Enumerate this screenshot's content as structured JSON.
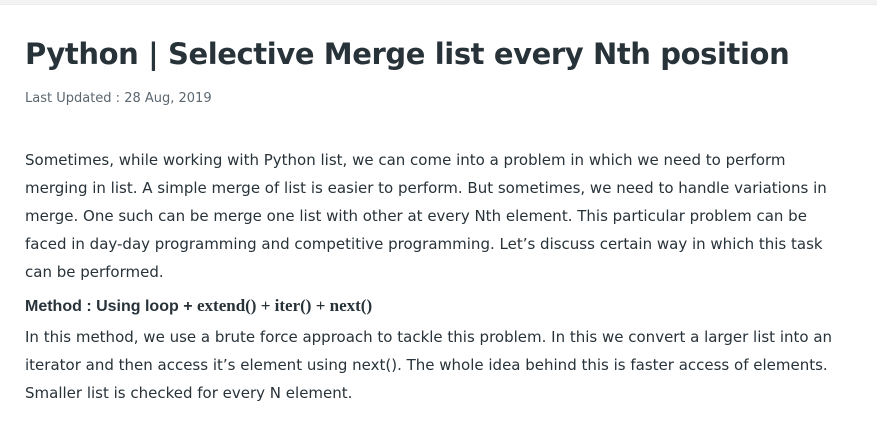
{
  "article": {
    "title": "Python | Selective Merge list every Nth position",
    "last_updated": "Last Updated : 28 Aug, 2019",
    "intro_lines": [
      "Sometimes, while working with Python list, we can come into a problem in which we need to perform",
      "merging in list. A simple merge of list is easier to perform. But sometimes, we need to handle variations in",
      "merge. One such can be merge one list with other at every Nth element. This particular problem can be",
      "faced in day-day programming and competitive programming. Let’s discuss certain way in which this task",
      "can be performed."
    ],
    "method_heading_label": "Method : Using loop + ",
    "method_heading_functions": "extend() + iter() + next()",
    "method_body_lines": [
      "In this method, we use a brute force approach to tackle this problem. In this we convert a larger list into an",
      "iterator and then access it’s element using next(). The whole idea behind this is faster access of elements.",
      "Smaller list is checked for every N element."
    ]
  }
}
